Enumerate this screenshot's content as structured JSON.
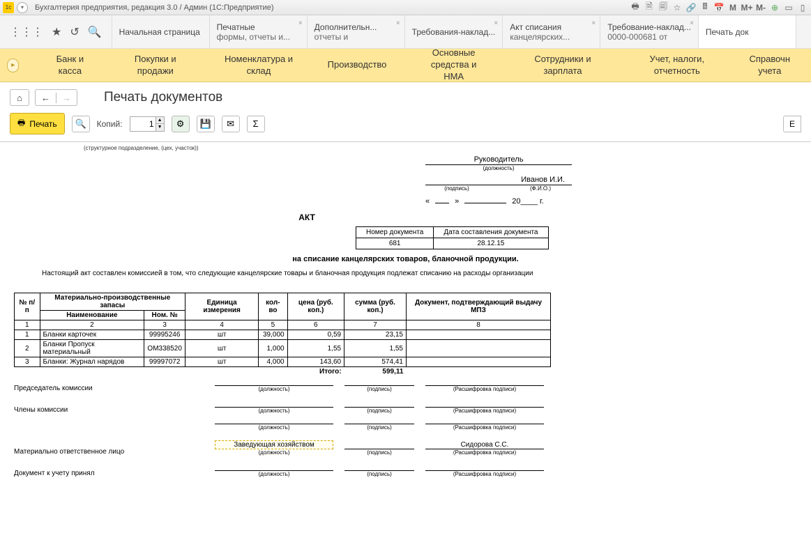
{
  "titlebar": {
    "title": "Бухгалтерия предприятия, редакция 3.0 / Админ  (1С:Предприятие)",
    "m1": "M",
    "m2": "M+",
    "m3": "M-"
  },
  "tabs": {
    "home": "Начальная страница",
    "t1a": "Печатные",
    "t1b": "формы, отчеты и...",
    "t2a": "Дополнительн...",
    "t2b": "отчеты и",
    "t3a": "Требования-наклад...",
    "t3b": "",
    "t4a": "Акт списания",
    "t4b": "канцелярских...",
    "t5a": "Требование-наклад...",
    "t5b": "0000-000681 от",
    "t6": "Печать док"
  },
  "menu": {
    "m1": "Банк и касса",
    "m2": "Покупки и продажи",
    "m3": "Номенклатура и склад",
    "m4": "Производство",
    "m5": "Основные средства и\nНМА",
    "m6": "Сотрудники и зарплата",
    "m7": "Учет, налоги, отчетность",
    "m8": "Справочн\nучета"
  },
  "page": {
    "title": "Печать документов",
    "print": "Печать",
    "copies_label": "Копий:",
    "copies": "1"
  },
  "doc": {
    "subnote": "(структурное подразделение, (цех, участок))",
    "head_title": "Руководитель",
    "head_pos": "(должность)",
    "head_name": "Иванов И.И.",
    "sign_lbl": "(подпись)",
    "fio_lbl": "(Ф.И.О.)",
    "date_open": "«",
    "date_close": "»",
    "year": "20____ г.",
    "title": "АКТ",
    "meta_h1": "Номер документа",
    "meta_h2": "Дата составления документа",
    "meta_v1": "681",
    "meta_v2": "28.12.15",
    "subtitle": "на списание канцелярских товаров, бланочной продукции.",
    "body": "Настоящий акт составлен комиссией в том, что следующие канцелярские товары и бланочная продукция подлежат списанию на расходы организации",
    "th_num": "№ п/п",
    "th_mpz": "Материально-производственные запасы",
    "th_name": "Наименование",
    "th_nom": "Ном. №",
    "th_unit": "Единица измерения",
    "th_qty": "кол-во",
    "th_price": "цена (руб. коп.)",
    "th_sum": "сумма (руб. коп.)",
    "th_doc": "Документ, подтверждающий выдачу МПЗ",
    "nums": {
      "c1": "1",
      "c2": "2",
      "c3": "3",
      "c4": "4",
      "c5": "5",
      "c6": "6",
      "c7": "7",
      "c8": "8"
    },
    "rows": [
      {
        "n": "1",
        "name": "Бланки карточек",
        "nom": "99995246",
        "unit": "шт",
        "qty": "39,000",
        "price": "0,59",
        "sum": "23,15"
      },
      {
        "n": "2",
        "name": "Бланки Пропуск материальный",
        "nom": "ОМ338520",
        "unit": "шт",
        "qty": "1,000",
        "price": "1,55",
        "sum": "1,55"
      },
      {
        "n": "3",
        "name": "Бланки: Журнал нарядов",
        "nom": "99997072",
        "unit": "шт",
        "qty": "4,000",
        "price": "143,60",
        "sum": "574,41"
      }
    ],
    "total_label": "Итого:",
    "total": "599,11",
    "sig_chair": "Председатель комиссии",
    "sig_members": "Члены комиссии",
    "sig_resp": "Материально ответственное лицо",
    "sig_accept": "Документ к учету принял",
    "sig_job": "(должность)",
    "sig_sign": "(подпись)",
    "sig_name": "(Расшифровка подписи)",
    "resp_job": "Заведующая хозяйством",
    "resp_name": "Сидорова С.С."
  }
}
